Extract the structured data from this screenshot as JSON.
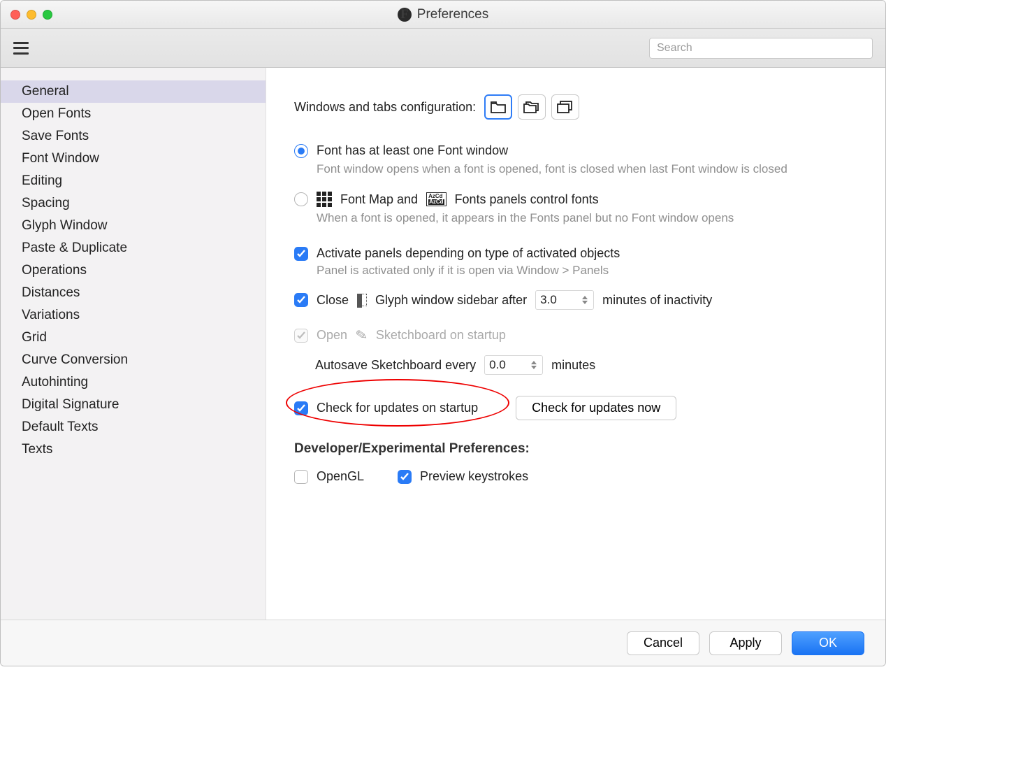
{
  "window": {
    "title": "Preferences"
  },
  "toolbar": {
    "search_placeholder": "Search"
  },
  "sidebar": {
    "items": [
      "General",
      "Open Fonts",
      "Save Fonts",
      "Font Window",
      "Editing",
      "Spacing",
      "Glyph Window",
      "Paste & Duplicate",
      "Operations",
      "Distances",
      "Variations",
      "Grid",
      "Curve Conversion",
      "Autohinting",
      "Digital Signature",
      "Default Texts",
      "Texts"
    ],
    "selected_index": 0
  },
  "content": {
    "windows_tabs_label": "Windows and tabs configuration:",
    "radio1": {
      "title": "Font has at least one Font window",
      "desc": "Font window opens when a font is opened, font is closed when last Font window is closed",
      "checked": true
    },
    "radio2": {
      "title_a": "Font Map and",
      "title_b": "Fonts panels control fonts",
      "desc": "When a font is opened, it appears in the Fonts panel but no Font window opens",
      "checked": false
    },
    "activate_panels": {
      "label": "Activate panels depending on type of activated objects",
      "desc": "Panel is activated only if it is open via Window > Panels",
      "checked": true
    },
    "close_sidebar": {
      "pre": "Close",
      "mid": "Glyph window sidebar after",
      "value": "3.0",
      "post": "minutes of inactivity",
      "checked": true
    },
    "open_sketchboard": {
      "pre": "Open",
      "post": "Sketchboard on startup",
      "checked": true,
      "disabled": true
    },
    "autosave": {
      "pre": "Autosave Sketchboard every",
      "value": "0.0",
      "post": "minutes"
    },
    "check_updates": {
      "label": "Check for updates on startup",
      "checked": true,
      "button": "Check for updates now"
    },
    "dev_header": "Developer/Experimental Preferences:",
    "opengl": {
      "label": "OpenGL",
      "checked": false
    },
    "preview_keys": {
      "label": "Preview keystrokes",
      "checked": true
    }
  },
  "footer": {
    "cancel": "Cancel",
    "apply": "Apply",
    "ok": "OK"
  }
}
